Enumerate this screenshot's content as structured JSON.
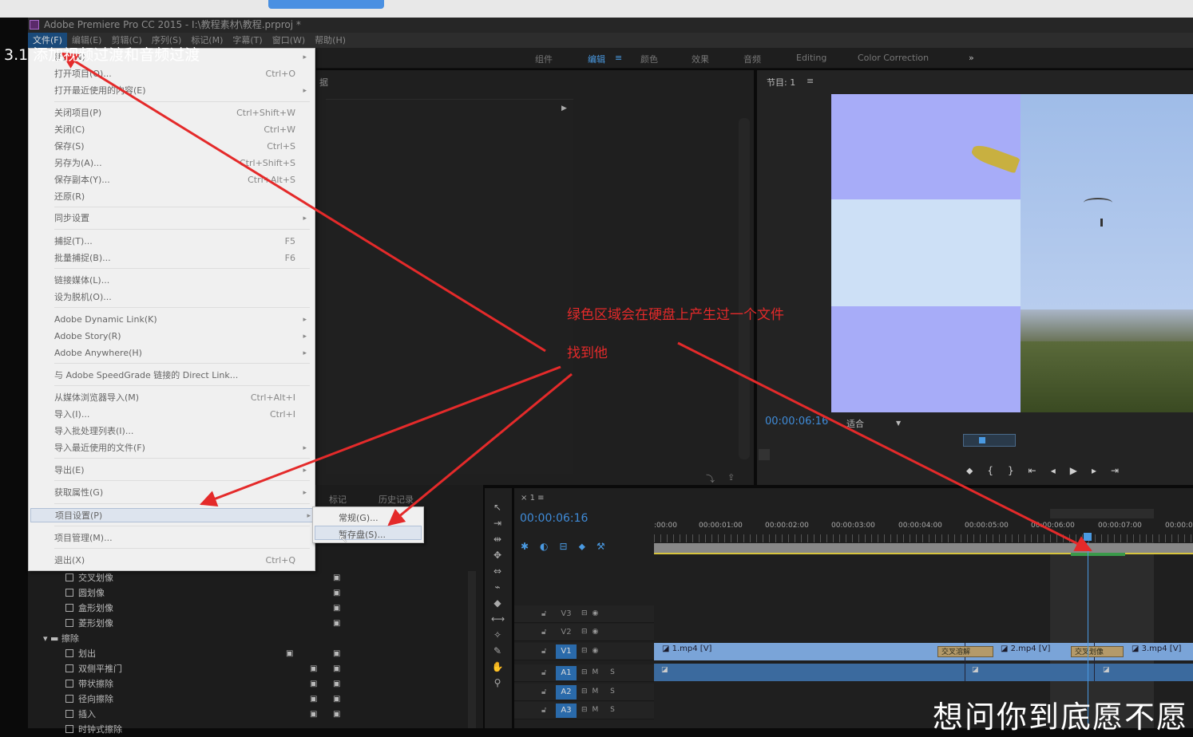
{
  "app": {
    "title": "Adobe Premiere Pro CC 2015 - I:\\教程素材\\教程.prproj *",
    "menubar": [
      "文件(F)",
      "编辑(E)",
      "剪辑(C)",
      "序列(S)",
      "标记(M)",
      "字幕(T)",
      "窗口(W)",
      "帮助(H)"
    ]
  },
  "overlay": {
    "heading": "3.1 添加视频过渡和音频过渡",
    "annotation1": "绿色区域会在硬盘上产生过一个文件",
    "annotation2": "找到他",
    "caption": "想问你到底愿不愿"
  },
  "workspace_tabs": [
    "组件",
    "编辑",
    "颜色",
    "效果",
    "音频",
    "Editing",
    "Color Correction",
    "»"
  ],
  "left_panel": {
    "tab_partial": "据",
    "tabs_lower": [
      "标记",
      "历史记录"
    ]
  },
  "file_menu": {
    "items": [
      {
        "label": "新建(N)",
        "shortcut": "",
        "submenu": true
      },
      {
        "label": "打开项目(O)...",
        "shortcut": "Ctrl+O"
      },
      {
        "label": "打开最近使用的内容(E)",
        "shortcut": "",
        "submenu": true
      },
      {
        "label": "关闭项目(P)",
        "shortcut": "Ctrl+Shift+W"
      },
      {
        "label": "关闭(C)",
        "shortcut": "Ctrl+W"
      },
      {
        "label": "保存(S)",
        "shortcut": "Ctrl+S"
      },
      {
        "label": "另存为(A)...",
        "shortcut": "Ctrl+Shift+S"
      },
      {
        "label": "保存副本(Y)...",
        "shortcut": "Ctrl+Alt+S"
      },
      {
        "label": "还原(R)",
        "shortcut": ""
      },
      {
        "label": "同步设置",
        "shortcut": "",
        "submenu": true
      },
      {
        "label": "捕捉(T)...",
        "shortcut": "F5"
      },
      {
        "label": "批量捕捉(B)...",
        "shortcut": "F6"
      },
      {
        "label": "链接媒体(L)...",
        "shortcut": ""
      },
      {
        "label": "设为脱机(O)...",
        "shortcut": ""
      },
      {
        "label": "Adobe Dynamic Link(K)",
        "shortcut": "",
        "submenu": true
      },
      {
        "label": "Adobe Story(R)",
        "shortcut": "",
        "submenu": true
      },
      {
        "label": "Adobe Anywhere(H)",
        "shortcut": "",
        "submenu": true
      },
      {
        "label": "与 Adobe SpeedGrade 链接的 Direct Link...",
        "shortcut": ""
      },
      {
        "label": "从媒体浏览器导入(M)",
        "shortcut": "Ctrl+Alt+I"
      },
      {
        "label": "导入(I)...",
        "shortcut": "Ctrl+I"
      },
      {
        "label": "导入批处理列表(I)...",
        "shortcut": ""
      },
      {
        "label": "导入最近使用的文件(F)",
        "shortcut": "",
        "submenu": true
      },
      {
        "label": "导出(E)",
        "shortcut": "",
        "submenu": true
      },
      {
        "label": "获取属性(G)",
        "shortcut": "",
        "submenu": true
      },
      {
        "label": "项目设置(P)",
        "shortcut": "",
        "submenu": true
      },
      {
        "label": "项目管理(M)...",
        "shortcut": ""
      },
      {
        "label": "退出(X)",
        "shortcut": "Ctrl+Q"
      }
    ],
    "submenu": [
      "常规(G)...",
      "暂存盘(S)..."
    ]
  },
  "program_monitor": {
    "title": "节目: 1",
    "timecode": "00:00:06:16",
    "fit": "适合"
  },
  "timeline": {
    "sequence": "1",
    "timecode": "00:00:06:16",
    "ruler": [
      ":00:00",
      "00:00:01:00",
      "00:00:02:00",
      "00:00:03:00",
      "00:00:04:00",
      "00:00:05:00",
      "00:00:06:00",
      "00:00:07:00",
      "00:00:0"
    ],
    "tracks": [
      {
        "name": "V3"
      },
      {
        "name": "V2"
      },
      {
        "name": "V1"
      },
      {
        "name": "A1"
      },
      {
        "name": "A2"
      },
      {
        "name": "A3"
      }
    ],
    "clips": [
      "1.mp4 [V]",
      "2.mp4 [V]",
      "3.mp4 [V]"
    ],
    "transitions": [
      "交叉溶解",
      "交叉划像"
    ],
    "track_flags": "M S"
  },
  "effects_tree": {
    "items": [
      {
        "label": "交叉划像"
      },
      {
        "label": "圆划像"
      },
      {
        "label": "盒形划像"
      },
      {
        "label": "菱形划像"
      },
      {
        "label": "擦除",
        "folder": true
      },
      {
        "label": "划出"
      },
      {
        "label": "双侧平推门"
      },
      {
        "label": "带状擦除"
      },
      {
        "label": "径向擦除"
      },
      {
        "label": "插入"
      },
      {
        "label": "时钟式擦除"
      }
    ]
  },
  "colors": {
    "accent": "#3f8bd8",
    "arrow": "#e42a2a",
    "clip_video": "#7aa4d8",
    "clip_audio": "#3b6a9e",
    "render_green": "#3a9a4a"
  }
}
